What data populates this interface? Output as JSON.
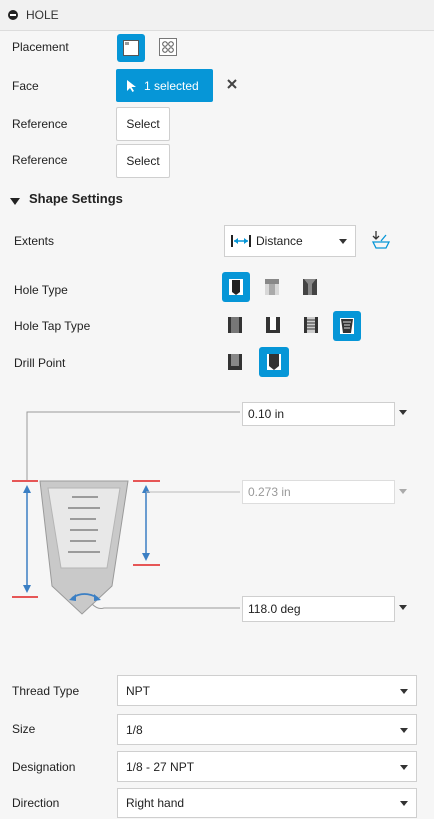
{
  "header": {
    "title": "HOLE"
  },
  "placement": {
    "label": "Placement"
  },
  "face": {
    "label": "Face",
    "button": "1 selected"
  },
  "reference1": {
    "label": "Reference",
    "button": "Select"
  },
  "reference2": {
    "label": "Reference",
    "button": "Select"
  },
  "shape_settings": {
    "title": "Shape Settings"
  },
  "extents": {
    "label": "Extents",
    "value": "Distance"
  },
  "hole_type": {
    "label": "Hole Type"
  },
  "hole_tap_type": {
    "label": "Hole Tap Type"
  },
  "drill_point": {
    "label": "Drill Point"
  },
  "dimensions": {
    "depth": "0.10 in",
    "tap_depth": "0.273 in",
    "angle": "118.0 deg"
  },
  "thread": [
    {
      "label": "Thread Type",
      "value": "NPT"
    },
    {
      "label": "Size",
      "value": "1/8"
    },
    {
      "label": "Designation",
      "value": "1/8 - 27 NPT"
    },
    {
      "label": "Direction",
      "value": "Right hand"
    }
  ],
  "colors": {
    "accent": "#0696d7",
    "dimension_red": "#e02020",
    "arrow_blue": "#3b7fc4"
  }
}
